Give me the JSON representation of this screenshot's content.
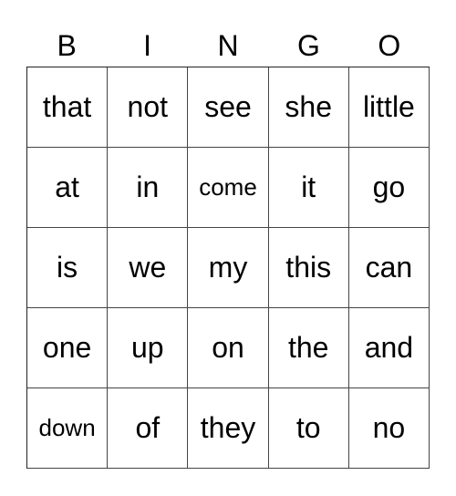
{
  "header": [
    "B",
    "I",
    "N",
    "G",
    "O"
  ],
  "rows": [
    [
      "that",
      "not",
      "see",
      "she",
      "little"
    ],
    [
      "at",
      "in",
      "come",
      "it",
      "go"
    ],
    [
      "is",
      "we",
      "my",
      "this",
      "can"
    ],
    [
      "one",
      "up",
      "on",
      "the",
      "and"
    ],
    [
      "down",
      "of",
      "they",
      "to",
      "no"
    ]
  ]
}
